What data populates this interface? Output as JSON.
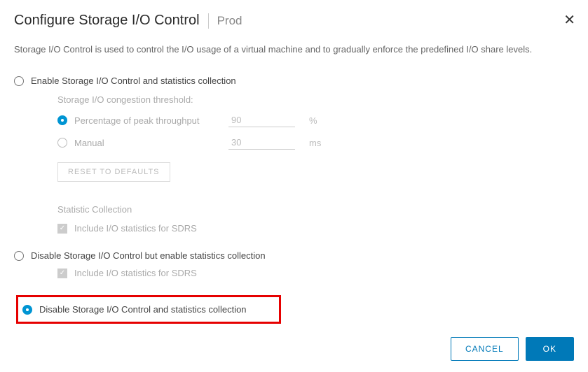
{
  "header": {
    "title": "Configure Storage I/O Control",
    "context": "Prod"
  },
  "description": "Storage I/O Control is used to control the I/O usage of a virtual machine and to gradually enforce the predefined I/O share levels.",
  "options": {
    "enable": {
      "label": "Enable Storage I/O Control and statistics collection",
      "threshold_title": "Storage I/O congestion threshold:",
      "percentage": {
        "label": "Percentage of peak throughput",
        "value": "90",
        "unit": "%"
      },
      "manual": {
        "label": "Manual",
        "value": "30",
        "unit": "ms"
      },
      "reset_label": "RESET TO DEFAULTS",
      "stats_title": "Statistic Collection",
      "include_sdrs": "Include I/O statistics for SDRS"
    },
    "disable_with_stats": {
      "label": "Disable Storage I/O Control but enable statistics collection",
      "include_sdrs": "Include I/O statistics for SDRS"
    },
    "disable_all": {
      "label": "Disable Storage I/O Control and statistics collection"
    }
  },
  "buttons": {
    "cancel": "CANCEL",
    "ok": "OK"
  }
}
